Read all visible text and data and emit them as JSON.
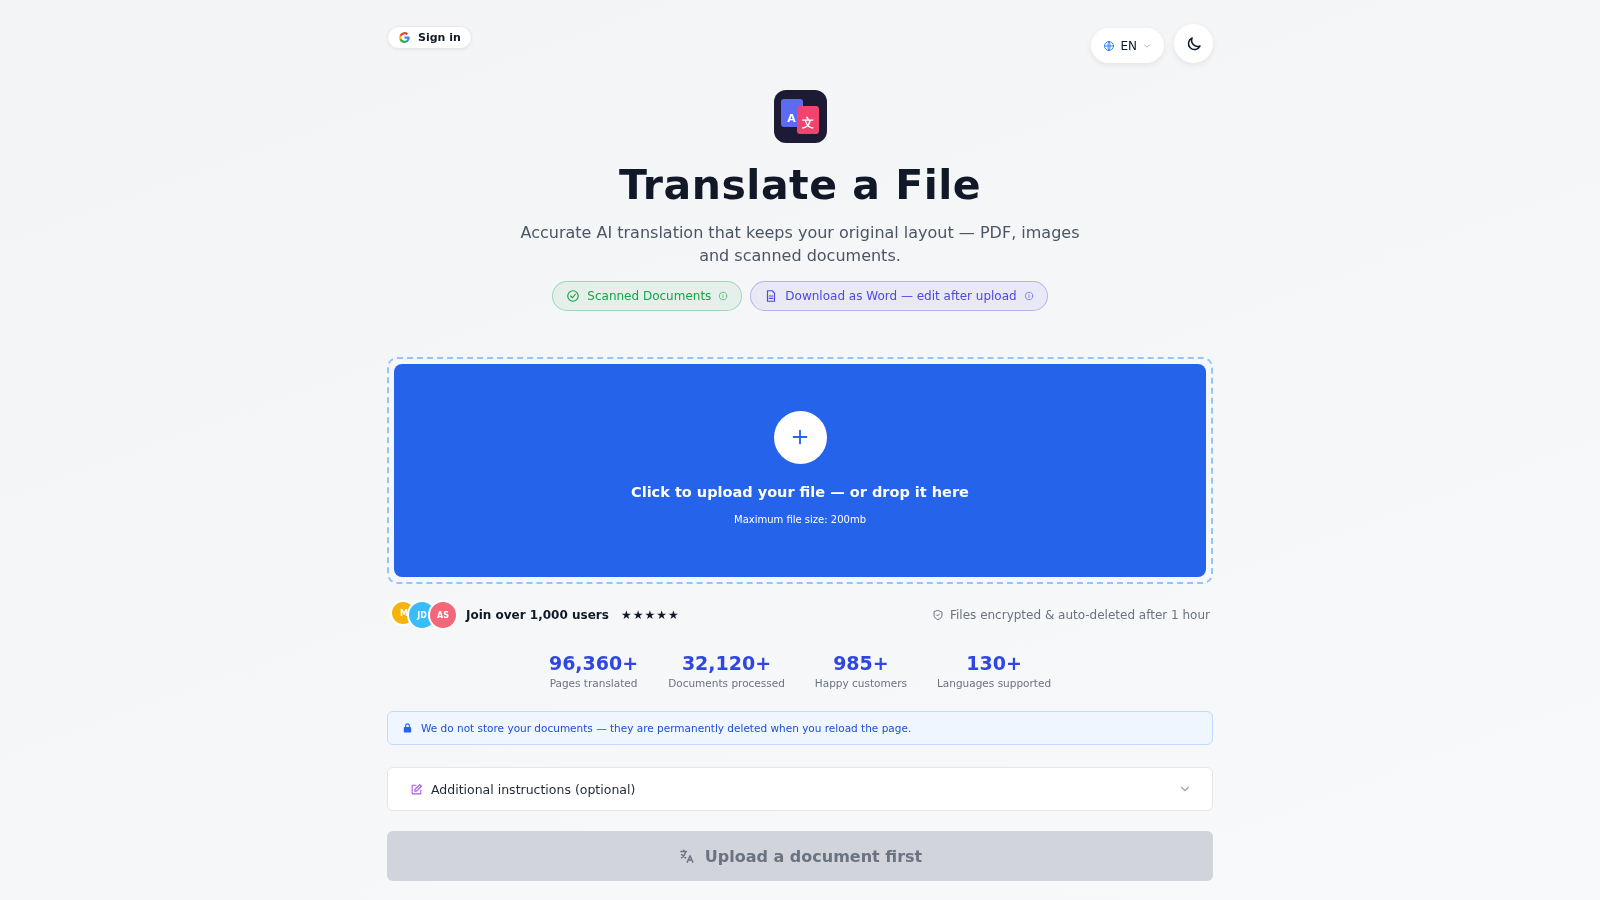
{
  "header": {
    "sign_in": "Sign in",
    "language": "EN"
  },
  "logo": {
    "glyphs": [
      "A",
      "文"
    ]
  },
  "title": "Translate a File",
  "subtitle": "Accurate AI translation that keeps your original layout — PDF, images and scanned documents.",
  "chips": [
    {
      "kind": "check",
      "label": "Scanned Documents"
    },
    {
      "kind": "doc",
      "label": "Download as Word — edit after upload"
    }
  ],
  "upload": {
    "title": "Click to upload your file — or drop it here",
    "hint": "Maximum file size: 200mb"
  },
  "social": {
    "avatars": [
      {
        "initials": "M",
        "color": "#f5b40b"
      },
      {
        "initials": "JD",
        "color": "#38bdf8"
      },
      {
        "initials": "AS",
        "color": "#f4667a"
      }
    ],
    "text": "Join over 1,000 users",
    "stars": 5,
    "security": "Files encrypted & auto-deleted after 1 hour"
  },
  "stats": [
    {
      "value": "96,360+",
      "label": "Pages translated"
    },
    {
      "value": "32,120+",
      "label": "Documents processed"
    },
    {
      "value": "985+",
      "label": "Happy customers"
    },
    {
      "value": "130+",
      "label": "Languages supported"
    }
  ],
  "notice": "We do not store your documents — they are permanently deleted when you reload the page.",
  "instructions": {
    "label": "Additional instructions (optional)",
    "expanded": false
  },
  "submit": {
    "label": "Upload a document first",
    "disabled": true
  }
}
